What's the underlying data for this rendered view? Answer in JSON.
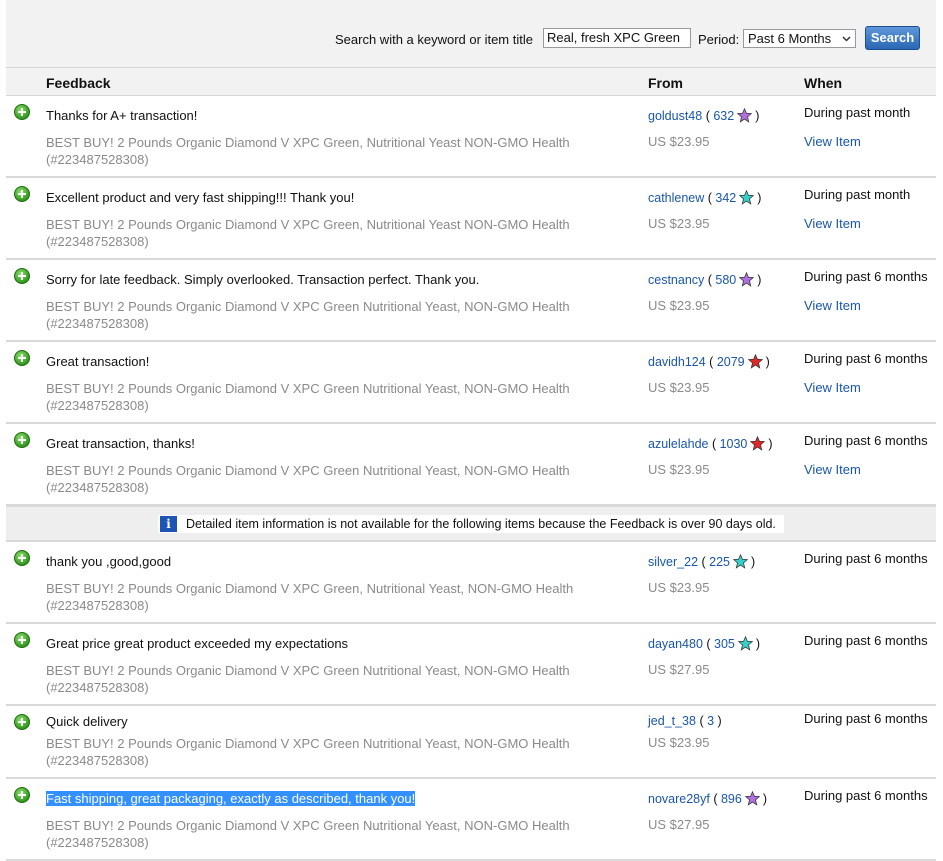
{
  "search": {
    "label": "Search with a keyword or item title",
    "value": "Real, fresh XPC Green",
    "period_label": "Period:",
    "period_value": "Past 6 Months",
    "button": "Search"
  },
  "headers": {
    "feedback": "Feedback",
    "from": "From",
    "when": "When"
  },
  "notice": "Detailed item information is not available for the following items because the Feedback is over 90 days old.",
  "rows": [
    {
      "comment": "Thanks for A+ transaction!",
      "user": "goldust48",
      "score": "632",
      "star_color": "#b070e0",
      "item": "BEST BUY! 2 Pounds Organic Diamond V XPC Green, Nutritional Yeast NON-GMO Health (#223487528308)",
      "price": "US $23.95",
      "when": "During past month",
      "view": "View Item"
    },
    {
      "comment": "Excellent product and very fast shipping!!! Thank you!",
      "user": "cathlenew",
      "score": "342",
      "star_color": "#37d0c8",
      "item": "BEST BUY! 2 Pounds Organic Diamond V XPC Green, Nutritional Yeast NON-GMO Health (#223487528308)",
      "price": "US $23.95",
      "when": "During past month",
      "view": "View Item"
    },
    {
      "comment": "Sorry for late feedback. Simply overlooked. Transaction perfect. Thank you.",
      "user": "cestnancy",
      "score": "580",
      "star_color": "#b070e0",
      "item": "BEST BUY! 2 Pounds Organic Diamond V XPC Green Nutritional Yeast, NON-GMO Health (#223487528308)",
      "price": "US $23.95",
      "when": "During past 6 months",
      "view": "View Item"
    },
    {
      "comment": "Great transaction!",
      "user": "davidh124",
      "score": "2079",
      "star_color": "#e02828",
      "item": "BEST BUY! 2 Pounds Organic Diamond V XPC Green Nutritional Yeast, NON-GMO Health (#223487528308)",
      "price": "US $23.95",
      "when": "During past 6 months",
      "view": "View Item"
    },
    {
      "comment": "Great transaction, thanks!",
      "user": "azulelahde",
      "score": "1030",
      "star_color": "#e02828",
      "item": "BEST BUY! 2 Pounds Organic Diamond V XPC Green Nutritional Yeast, NON-GMO Health (#223487528308)",
      "price": "US $23.95",
      "when": "During past 6 months",
      "view": "View Item"
    }
  ],
  "old_rows": [
    {
      "comment": "thank you ,good,good",
      "user": "silver_22",
      "score": "225",
      "star_color": "#37d0c8",
      "item": "BEST BUY! 2 Pounds Organic Diamond V XPC Green, Nutritional Yeast, NON-GMO Health (#223487528308)",
      "price": "US $23.95",
      "when": "During past 6 months"
    },
    {
      "comment": "Great price great product exceeded my expectations",
      "user": "dayan480",
      "score": "305",
      "star_color": "#37d0c8",
      "item": "BEST BUY! 2 Pounds Organic Diamond V XPC Green Nutritional Yeast, NON-GMO Health (#223487528308)",
      "price": "US $27.95",
      "when": "During past 6 months"
    },
    {
      "comment": "Quick delivery",
      "user": "jed_t_38",
      "score": "3",
      "star_color": "",
      "item": "BEST BUY! 2 Pounds Organic Diamond V XPC Green Nutritional Yeast, NON-GMO Health (#223487528308)",
      "price": "US $23.95",
      "when": "During past 6 months"
    },
    {
      "comment": "Fast shipping, great packaging, exactly as described, thank you!",
      "user": "novare28yf",
      "score": "896",
      "star_color": "#b070e0",
      "item": "BEST BUY! 2 Pounds Organic Diamond V XPC Green Nutritional Yeast, NON-GMO Health (#223487528308)",
      "price": "US $27.95",
      "when": "During past 6 months"
    }
  ]
}
